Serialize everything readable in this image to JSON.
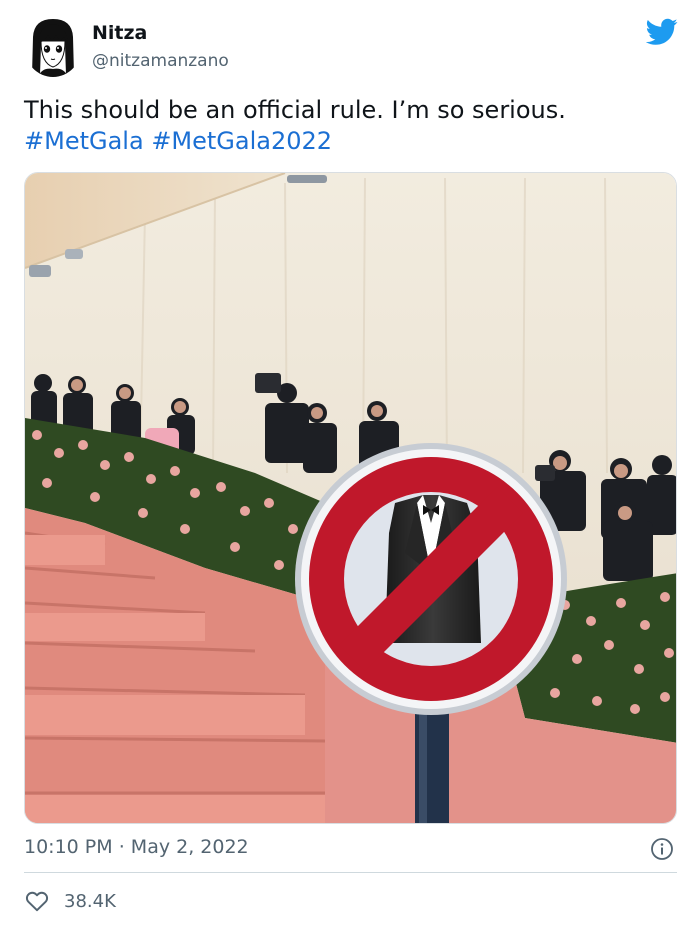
{
  "user": {
    "display_name": "Nitza",
    "handle": "@nitzamanzano",
    "avatar_icon": "anime-girl-avatar"
  },
  "tweet": {
    "text": "This should be an official rule. I’m so serious.",
    "hashtags": [
      "#MetGala",
      "#MetGala2022"
    ],
    "media_icon": "no-tuxedo-sign-photo"
  },
  "meta": {
    "time": "10:10 PM",
    "separator": "·",
    "date": "May 2, 2022"
  },
  "stats": {
    "likes": "38.4K"
  },
  "colors": {
    "hashtag": "#1b6fd3",
    "twitter_blue": "#1d9bf0",
    "secondary_text": "#536471"
  }
}
